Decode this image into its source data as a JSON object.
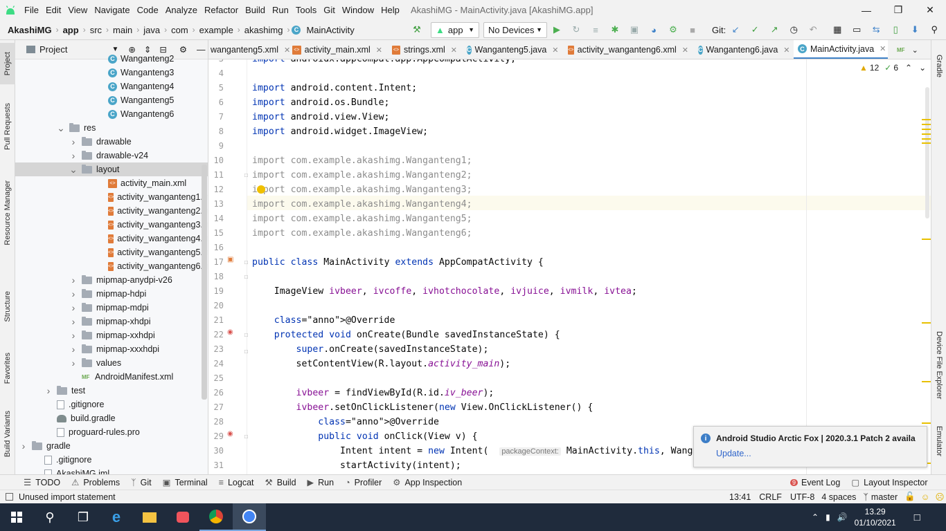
{
  "menubar": {
    "items": [
      "File",
      "Edit",
      "View",
      "Navigate",
      "Code",
      "Analyze",
      "Refactor",
      "Build",
      "Run",
      "Tools",
      "Git",
      "Window",
      "Help"
    ],
    "title": "AkashiMG - MainActivity.java [AkashiMG.app]"
  },
  "navbar": {
    "crumbs": [
      "AkashiMG",
      "app",
      "src",
      "main",
      "java",
      "com",
      "example",
      "akashimg",
      "MainActivity"
    ],
    "run_config": "app",
    "device": "No Devices",
    "git_label": "Git:"
  },
  "project_panel": {
    "title": "Project",
    "tree": [
      {
        "label": "Wanganteng2",
        "icon": "class",
        "indent": 134,
        "arrow": ""
      },
      {
        "label": "Wanganteng3",
        "icon": "class",
        "indent": 134,
        "arrow": ""
      },
      {
        "label": "Wanganteng4",
        "icon": "class",
        "indent": 134,
        "arrow": ""
      },
      {
        "label": "Wanganteng5",
        "icon": "class",
        "indent": 134,
        "arrow": ""
      },
      {
        "label": "Wanganteng6",
        "icon": "class",
        "indent": 134,
        "arrow": ""
      },
      {
        "label": "res",
        "icon": "folder",
        "indent": 78,
        "arrow": "open"
      },
      {
        "label": "drawable",
        "icon": "folder",
        "indent": 96,
        "arrow": "closed"
      },
      {
        "label": "drawable-v24",
        "icon": "folder",
        "indent": 96,
        "arrow": "closed"
      },
      {
        "label": "layout",
        "icon": "folder",
        "indent": 96,
        "arrow": "open",
        "selected": true
      },
      {
        "label": "activity_main.xml",
        "icon": "xml",
        "indent": 134,
        "arrow": ""
      },
      {
        "label": "activity_wanganteng1.xml",
        "icon": "xml",
        "indent": 134,
        "arrow": ""
      },
      {
        "label": "activity_wanganteng2.xml",
        "icon": "xml",
        "indent": 134,
        "arrow": ""
      },
      {
        "label": "activity_wanganteng3.xml",
        "icon": "xml",
        "indent": 134,
        "arrow": ""
      },
      {
        "label": "activity_wanganteng4.xml",
        "icon": "xml",
        "indent": 134,
        "arrow": ""
      },
      {
        "label": "activity_wanganteng5.xml",
        "icon": "xml",
        "indent": 134,
        "arrow": ""
      },
      {
        "label": "activity_wanganteng6.xml",
        "icon": "xml",
        "indent": 134,
        "arrow": ""
      },
      {
        "label": "mipmap-anydpi-v26",
        "icon": "folder",
        "indent": 96,
        "arrow": "closed"
      },
      {
        "label": "mipmap-hdpi",
        "icon": "folder",
        "indent": 96,
        "arrow": "closed"
      },
      {
        "label": "mipmap-mdpi",
        "icon": "folder",
        "indent": 96,
        "arrow": "closed"
      },
      {
        "label": "mipmap-xhdpi",
        "icon": "folder",
        "indent": 96,
        "arrow": "closed"
      },
      {
        "label": "mipmap-xxhdpi",
        "icon": "folder",
        "indent": 96,
        "arrow": "closed"
      },
      {
        "label": "mipmap-xxxhdpi",
        "icon": "folder",
        "indent": 96,
        "arrow": "closed"
      },
      {
        "label": "values",
        "icon": "folder",
        "indent": 96,
        "arrow": "closed"
      },
      {
        "label": "AndroidManifest.xml",
        "icon": "manifest",
        "indent": 96,
        "arrow": ""
      },
      {
        "label": "test",
        "icon": "folder",
        "indent": 60,
        "arrow": "closed"
      },
      {
        "label": ".gitignore",
        "icon": "file",
        "indent": 60,
        "arrow": ""
      },
      {
        "label": "build.gradle",
        "icon": "gradle",
        "indent": 60,
        "arrow": ""
      },
      {
        "label": "proguard-rules.pro",
        "icon": "file",
        "indent": 60,
        "arrow": ""
      },
      {
        "label": "gradle",
        "icon": "folder",
        "indent": 24,
        "arrow": "closed"
      },
      {
        "label": ".gitignore",
        "icon": "file",
        "indent": 42,
        "arrow": ""
      },
      {
        "label": "AkashiMG.iml",
        "icon": "file",
        "indent": 42,
        "arrow": ""
      }
    ]
  },
  "tabs": [
    {
      "label": "wanganteng5.xml",
      "icon": "xml"
    },
    {
      "label": "activity_main.xml",
      "icon": "xml"
    },
    {
      "label": "strings.xml",
      "icon": "xml"
    },
    {
      "label": "Wanganteng5.java",
      "icon": "class"
    },
    {
      "label": "activity_wanganteng6.xml",
      "icon": "xml"
    },
    {
      "label": "Wanganteng6.java",
      "icon": "class"
    },
    {
      "label": "MainActivity.java",
      "icon": "class",
      "active": true
    }
  ],
  "editor": {
    "warnings": "12",
    "weak_warnings": "6",
    "param_hint": "packageContext:",
    "lines": [
      {
        "n": "3",
        "code": "import androidx.appcompat.app.AppCompatActivity;"
      },
      {
        "n": "4",
        "code": ""
      },
      {
        "n": "5",
        "code": "import android.content.Intent;"
      },
      {
        "n": "6",
        "code": "import android.os.Bundle;"
      },
      {
        "n": "7",
        "code": "import android.view.View;"
      },
      {
        "n": "8",
        "code": "import android.widget.ImageView;"
      },
      {
        "n": "9",
        "code": ""
      },
      {
        "n": "10",
        "code": "import com.example.akashimg.Wanganteng1;"
      },
      {
        "n": "11",
        "code": "import com.example.akashimg.Wanganteng2;"
      },
      {
        "n": "12",
        "code": "import com.example.akashimg.Wanganteng3;"
      },
      {
        "n": "13",
        "code": "import com.example.akashimg.Wanganteng4;"
      },
      {
        "n": "14",
        "code": "import com.example.akashimg.Wanganteng5;"
      },
      {
        "n": "15",
        "code": "import com.example.akashimg.Wanganteng6;"
      },
      {
        "n": "16",
        "code": ""
      },
      {
        "n": "17",
        "code": "public class MainActivity extends AppCompatActivity {"
      },
      {
        "n": "18",
        "code": ""
      },
      {
        "n": "19",
        "code": "    ImageView ivbeer, ivcoffe, ivhotchocolate, ivjuice, ivmilk, ivtea;"
      },
      {
        "n": "20",
        "code": ""
      },
      {
        "n": "21",
        "code": "    @Override"
      },
      {
        "n": "22",
        "code": "    protected void onCreate(Bundle savedInstanceState) {"
      },
      {
        "n": "23",
        "code": "        super.onCreate(savedInstanceState);"
      },
      {
        "n": "24",
        "code": "        setContentView(R.layout.activity_main);"
      },
      {
        "n": "25",
        "code": ""
      },
      {
        "n": "26",
        "code": "        ivbeer = findViewById(R.id.iv_beer);"
      },
      {
        "n": "27",
        "code": "        ivbeer.setOnClickListener(new View.OnClickListener() {"
      },
      {
        "n": "28",
        "code": "            @Override"
      },
      {
        "n": "29",
        "code": "            public void onClick(View v) {"
      },
      {
        "n": "30",
        "code": "                Intent intent = new Intent(  MainActivity.this, Wang"
      },
      {
        "n": "31",
        "code": "                startActivity(intent);"
      }
    ]
  },
  "notification": {
    "title": "Android Studio Arctic Fox | 2020.3.1 Patch 2 availa",
    "link": "Update..."
  },
  "left_tool_tabs": [
    "Project",
    "Pull Requests",
    "Resource Manager",
    "Structure",
    "Favorites",
    "Build Variants"
  ],
  "right_tool_tabs": [
    "Gradle",
    "Device File Explorer",
    "Emulator"
  ],
  "bottom_tabs": [
    "TODO",
    "Problems",
    "Git",
    "Terminal",
    "Logcat",
    "Build",
    "Run",
    "Profiler",
    "App Inspection"
  ],
  "bottom_right_tabs": [
    "Event Log",
    "Layout Inspector"
  ],
  "event_log_count": "9",
  "status": {
    "message": "Unused import statement",
    "position": "13:41",
    "line_sep": "CRLF",
    "encoding": "UTF-8",
    "indent": "4 spaces",
    "branch": "master"
  },
  "taskbar": {
    "time": "13.29",
    "date": "01/10/2021"
  },
  "colors": {
    "keyword": "#0033b3",
    "accent": "#4083c9",
    "taskbar": "#1f2b3c"
  }
}
